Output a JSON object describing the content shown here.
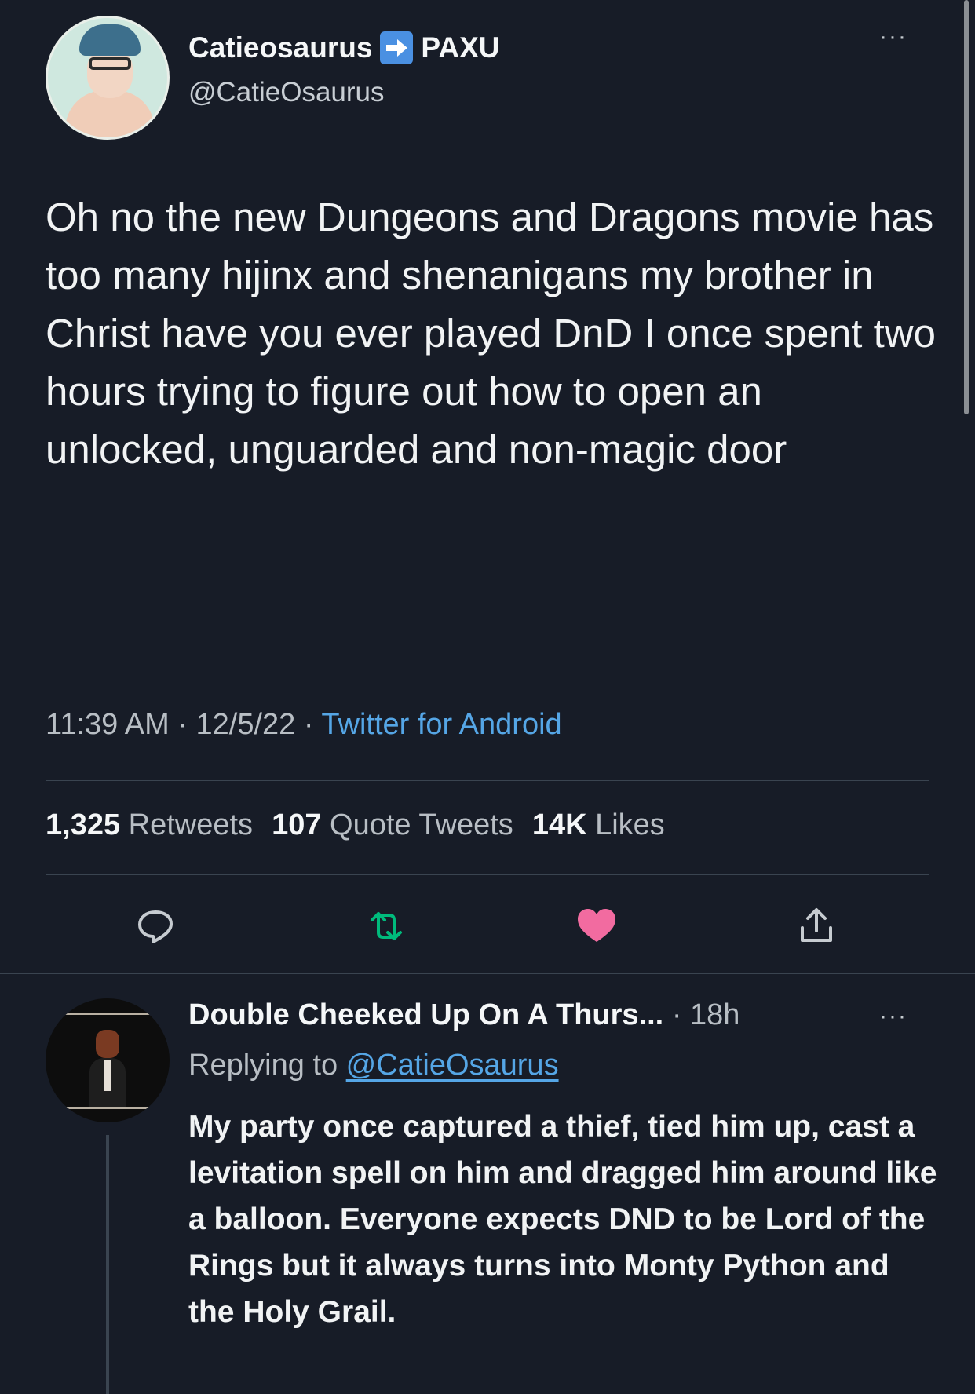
{
  "tweet": {
    "display_name": "Catieosaurus",
    "display_name_suffix": "PAXU",
    "handle": "@CatieOsaurus",
    "text": "Oh no the new Dungeons and Dragons movie has too many hijinx and shenanigans my brother in Christ have you ever played DnD I once spent two hours trying to figure out how to open an unlocked, unguarded and non-magic door",
    "time": "11:39 AM",
    "date": "12/5/22",
    "source": "Twitter for Android",
    "retweets_count": "1,325",
    "retweets_label": "Retweets",
    "quotes_count": "107",
    "quotes_label": "Quote Tweets",
    "likes_count": "14K",
    "likes_label": "Likes",
    "more": "···",
    "sep": " · "
  },
  "reply": {
    "display_name": "Double Cheeked Up On A Thurs...",
    "time": "· 18h",
    "replying_prefix": "Replying to ",
    "replying_to": "@CatieOsaurus",
    "text": "My party once captured a thief, tied him up, cast a levitation spell on him and dragged him around like a balloon. Everyone expects DND to be Lord of the Rings but it always turns into Monty Python and the Holy Grail.",
    "more": "···"
  },
  "icons": {
    "reply": "reply-icon",
    "retweet": "retweet-icon",
    "like": "heart-icon",
    "share": "share-icon",
    "arrow_emoji": "right-arrow-emoji"
  },
  "colors": {
    "background": "#171c27",
    "link": "#55a6e6",
    "retweet": "#00ba7c",
    "like": "#f91880"
  }
}
